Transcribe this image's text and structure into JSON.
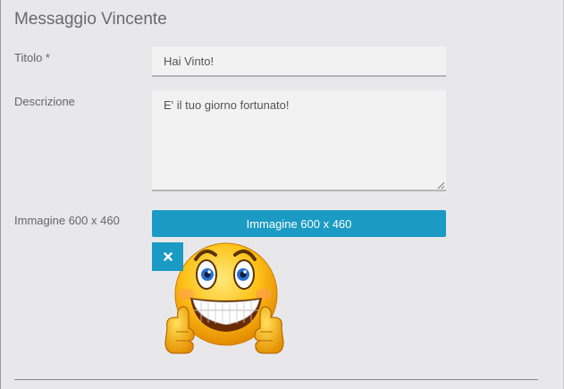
{
  "form": {
    "title": "Messaggio Vincente",
    "fields": {
      "titolo": {
        "label": "Titolo *",
        "value": "Hai Vinto!"
      },
      "descrizione": {
        "label": "Descrizione",
        "value": "E' il tuo giorno fortunato!"
      },
      "immagine": {
        "label": "Immagine 600 x 460",
        "button_label": "Immagine 600 x 460"
      }
    }
  },
  "icons": {
    "remove": "close-icon",
    "preview": "smiley-thumbs-up-emoji"
  },
  "colors": {
    "accent": "#1b9ac4",
    "background": "#e8e8ea",
    "field_background": "#f2f2f2"
  }
}
